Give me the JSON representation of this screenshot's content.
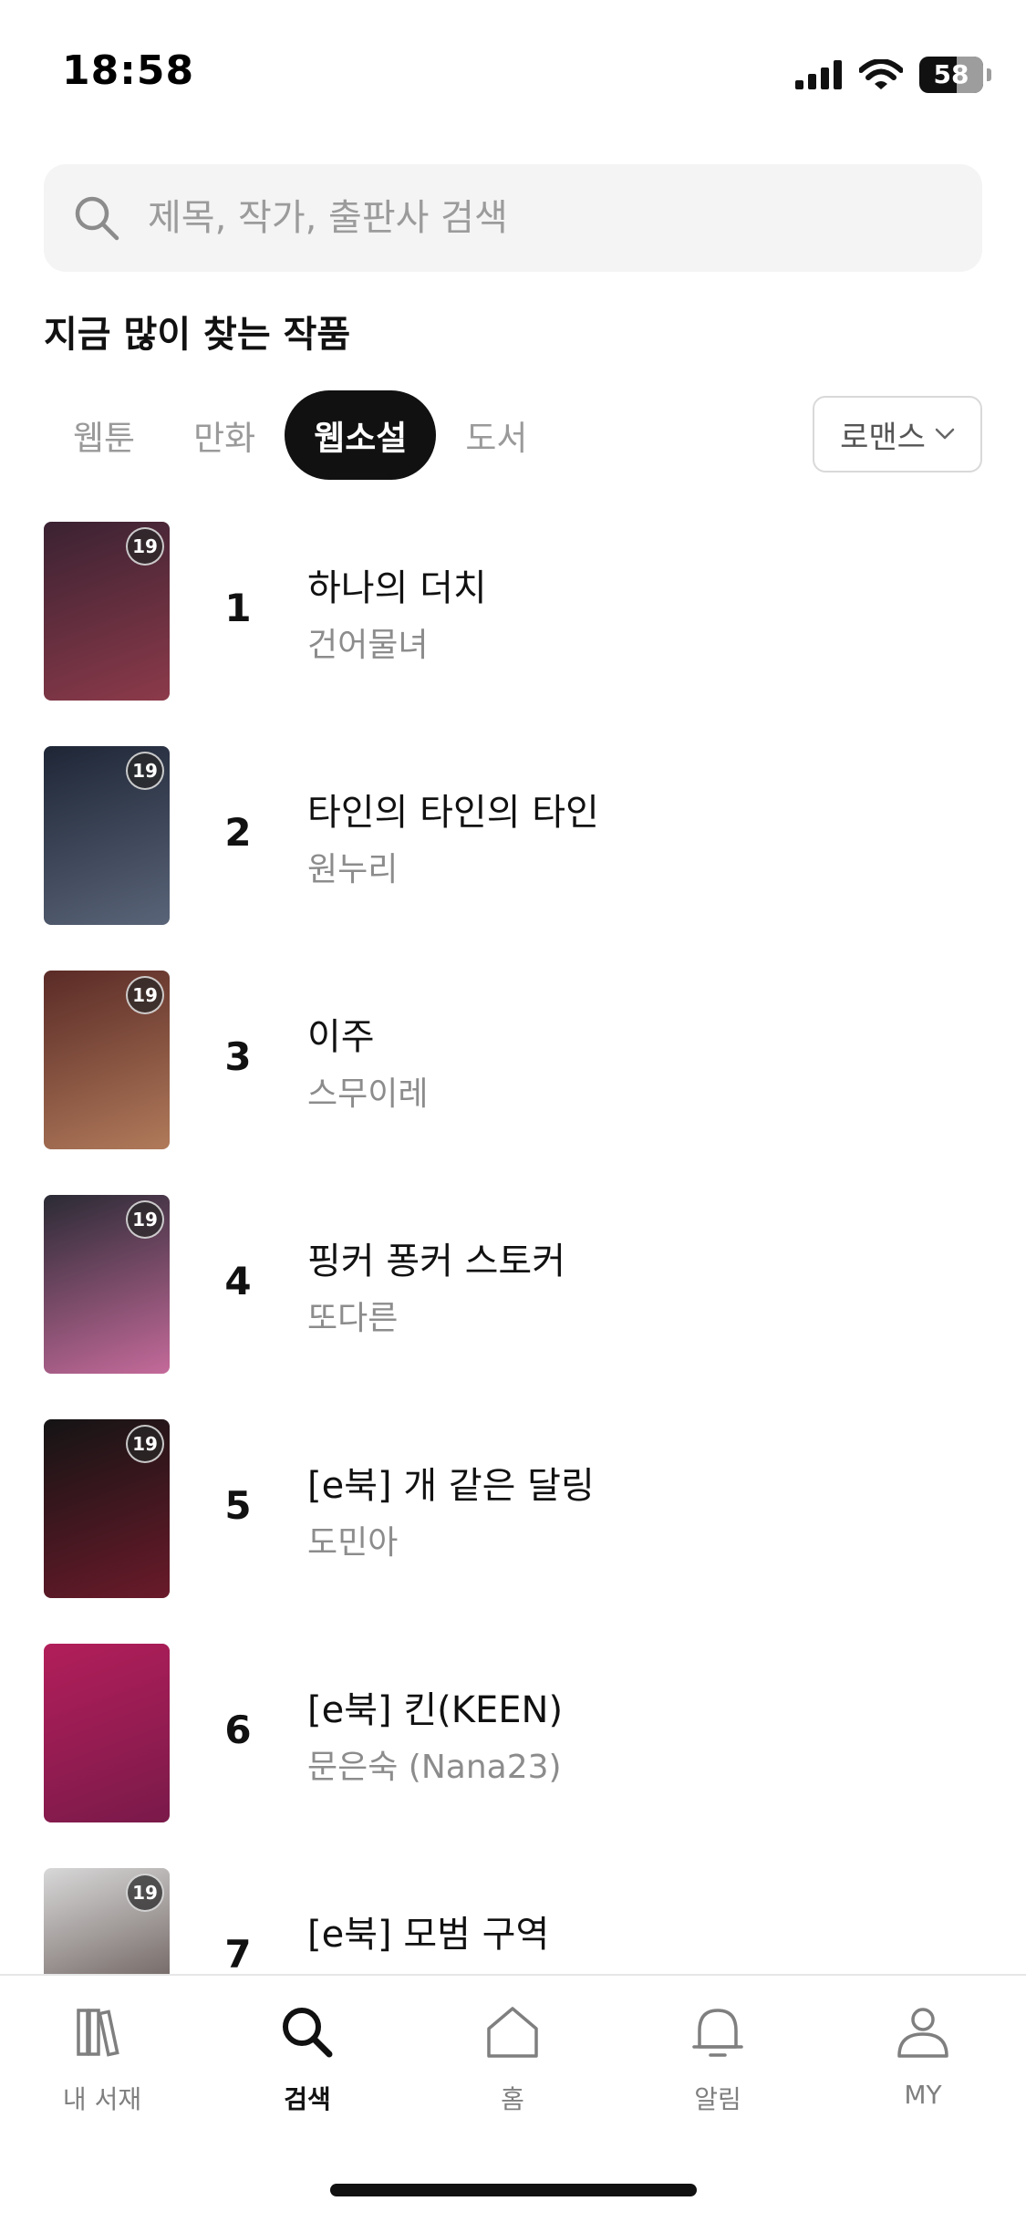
{
  "status_bar": {
    "time": "18:58",
    "battery": "58",
    "battery_level": 0.58
  },
  "search": {
    "placeholder": "제목, 작가, 출판사 검색",
    "value": ""
  },
  "section_title": "지금 많이 찾는 작품",
  "tabs": [
    {
      "label": "웹툰",
      "active": false
    },
    {
      "label": "만화",
      "active": false
    },
    {
      "label": "웹소설",
      "active": true
    },
    {
      "label": "도서",
      "active": false
    }
  ],
  "genre_filter": {
    "selected": "로맨스"
  },
  "rankings": [
    {
      "rank": "1",
      "title": "하나의 더치",
      "author": "건어물녀",
      "badge": "19",
      "cover_colors": [
        "#3a2232",
        "#8c3a4a"
      ]
    },
    {
      "rank": "2",
      "title": "타인의 타인의 타인",
      "author": "원누리",
      "badge": "19",
      "cover_colors": [
        "#1e2636",
        "#5a6478"
      ]
    },
    {
      "rank": "3",
      "title": "이주",
      "author": "스무이레",
      "badge": "19",
      "cover_colors": [
        "#5a2a26",
        "#b07a5a"
      ]
    },
    {
      "rank": "4",
      "title": "핑커 퐁커 스토커",
      "author": "또다른",
      "badge": "19",
      "cover_colors": [
        "#2a2a34",
        "#c46a9a"
      ]
    },
    {
      "rank": "5",
      "title": "[e북] 개 같은 달링",
      "author": "도민아",
      "badge": "19",
      "cover_colors": [
        "#141414",
        "#6a1a2a"
      ]
    },
    {
      "rank": "6",
      "title": "[e북] 킨(KEEN)",
      "author": "문은숙 (Nana23)",
      "badge": "",
      "cover_colors": [
        "#b21e5a",
        "#7a1a4a"
      ]
    },
    {
      "rank": "7",
      "title": "[e북] 모범 구역",
      "author": "",
      "badge": "19",
      "cover_colors": [
        "#d8d8d8",
        "#4a3a36"
      ]
    }
  ],
  "bottom_nav": [
    {
      "label": "내 서재",
      "icon": "library-icon",
      "active": false
    },
    {
      "label": "검색",
      "icon": "search-icon",
      "active": true
    },
    {
      "label": "홈",
      "icon": "home-icon",
      "active": false
    },
    {
      "label": "알림",
      "icon": "bell-icon",
      "active": false
    },
    {
      "label": "MY",
      "icon": "user-icon",
      "active": false
    }
  ]
}
